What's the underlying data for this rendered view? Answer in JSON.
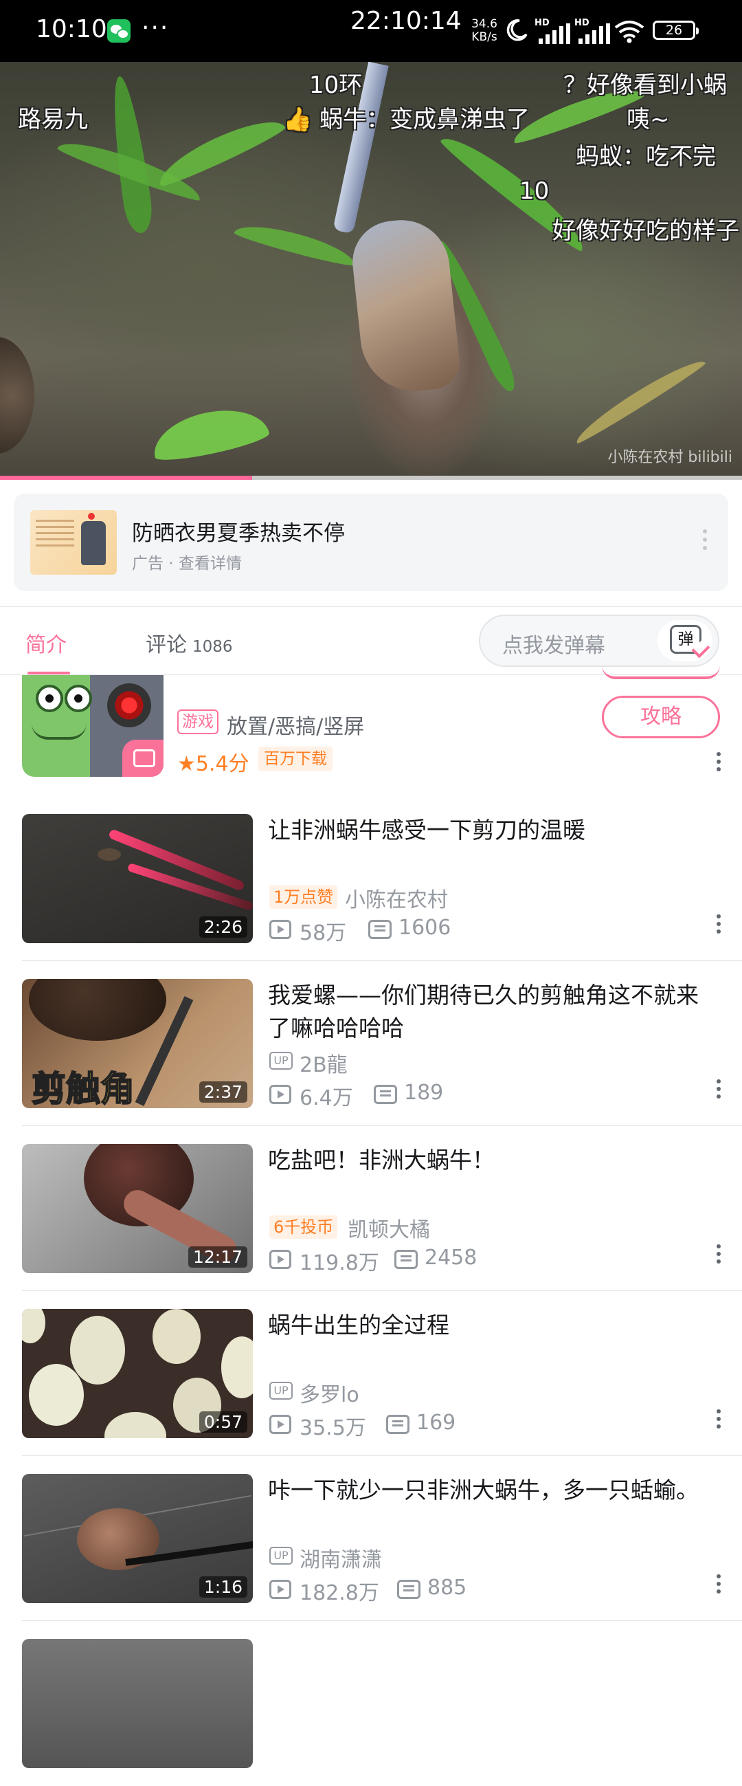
{
  "status_bar": {
    "time": "10:10",
    "dots": "···",
    "clock": "22:10:14",
    "net_speed_value": "34.6",
    "net_speed_unit": "KB/s",
    "hd1": "HD",
    "hd2": "HD",
    "battery": "26"
  },
  "video": {
    "danmaku": [
      "10环",
      "？好像看到小蜗",
      "路易九",
      "👍 蜗牛：变成鼻涕虫了",
      "咦~",
      "蚂蚁：吃不完",
      "10",
      "好像好好吃的样子"
    ],
    "watermark": "小陈在农村 bilibili",
    "progress": 0.34
  },
  "ad": {
    "title": "防晒衣男夏季热卖不停",
    "subtitle": "广告 · 查看详情"
  },
  "tabs": {
    "intro": "简介",
    "comments": "评论",
    "comment_count": "1086",
    "danmaku_placeholder": "点我发弹幕",
    "danmaku_btn": "弹"
  },
  "game": {
    "category": "游戏",
    "tags": "放置/恶搞/竖屏",
    "score": "5.4分",
    "downloads": "百万下载",
    "guide_button": "攻略"
  },
  "videos": [
    {
      "title": "让非洲蜗牛感受一下剪刀的温暖",
      "badge": "1万点赞",
      "author": "小陈在农村",
      "views": "58万",
      "danmaku": "1606",
      "duration": "2:26"
    },
    {
      "title": "我爱螺——你们期待已久的剪触角这不就来了嘛哈哈哈哈",
      "up": "UP",
      "author": "2B龍",
      "views": "6.4万",
      "danmaku": "189",
      "duration": "2:37",
      "thumb_text": "剪触角"
    },
    {
      "title": "吃盐吧！非洲大蜗牛！",
      "badge": "6千投币",
      "author": "凯顿大橘",
      "views": "119.8万",
      "danmaku": "2458",
      "duration": "12:17"
    },
    {
      "title": "蜗牛出生的全过程",
      "up": "UP",
      "author": "多罗lo",
      "views": "35.5万",
      "danmaku": "169",
      "duration": "0:57"
    },
    {
      "title": "咔一下就少一只非洲大蜗牛，多一只蛞蝓。",
      "up": "UP",
      "author": "湖南潇潇",
      "views": "182.8万",
      "danmaku": "885",
      "duration": "1:16"
    }
  ],
  "colors": {
    "accent_pink": "#fb7299",
    "orange": "#ff7f24",
    "text_gray": "#9499a0"
  }
}
